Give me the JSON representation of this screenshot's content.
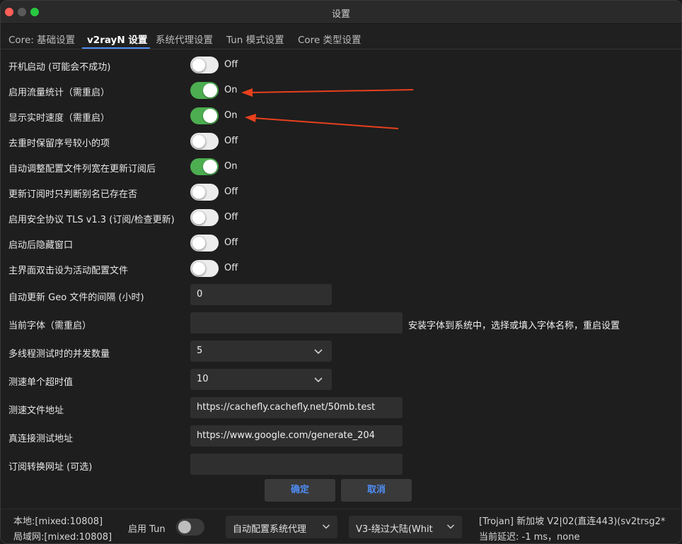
{
  "window": {
    "title": "设置"
  },
  "tabs": [
    {
      "label": "Core: 基础设置"
    },
    {
      "label": "v2rayN 设置"
    },
    {
      "label": "系统代理设置"
    },
    {
      "label": "Tun 模式设置"
    },
    {
      "label": "Core 类型设置"
    }
  ],
  "settings": {
    "toggles": [
      {
        "label": "开机启动 (可能会不成功)",
        "state": "Off"
      },
      {
        "label": "启用流量统计（需重启）",
        "state": "On"
      },
      {
        "label": "显示实时速度（需重启）",
        "state": "On"
      },
      {
        "label": "去重时保留序号较小的项",
        "state": "Off"
      },
      {
        "label": "自动调整配置文件列宽在更新订阅后",
        "state": "On"
      },
      {
        "label": "更新订阅时只判断别名已存在否",
        "state": "Off"
      },
      {
        "label": "启用安全协议 TLS v1.3 (订阅/检查更新)",
        "state": "Off"
      },
      {
        "label": "启动后隐藏窗口",
        "state": "Off"
      },
      {
        "label": "主界面双击设为活动配置文件",
        "state": "Off"
      }
    ],
    "geo_interval": {
      "label": "自动更新 Geo 文件的间隔 (小时)",
      "value": "0"
    },
    "font": {
      "label": "当前字体（需重启）",
      "value": "",
      "hint": "安装字体到系统中，选择或填入字体名称，重启设置"
    },
    "concurrency": {
      "label": "多线程测试时的并发数量",
      "value": "5"
    },
    "timeout": {
      "label": "测速单个超时值",
      "value": "10"
    },
    "speed_url": {
      "label": "测速文件地址",
      "value": "https://cachefly.cachefly.net/50mb.test"
    },
    "real_ping_url": {
      "label": "真连接测试地址",
      "value": "https://www.google.com/generate_204"
    },
    "sub_convert_url": {
      "label": "订阅转换网址 (可选)",
      "value": ""
    }
  },
  "buttons": {
    "ok": "确定",
    "cancel": "取消"
  },
  "statusbar": {
    "local": "本地:[mixed:10808]",
    "lan": "局域网:[mixed:10808]",
    "tun_label": "启用 Tun",
    "proxy_mode": "自动配置系统代理",
    "routing": "V3-绕过大陆(Whit",
    "server": "[Trojan] 新加坡 V2|02(直连443)(sv2trsg2*",
    "latency": "当前延迟: -1 ms，none"
  },
  "colors": {
    "accent": "#4f8ef7",
    "toggle_on": "#4cae50",
    "arrow": "#e8401c"
  }
}
